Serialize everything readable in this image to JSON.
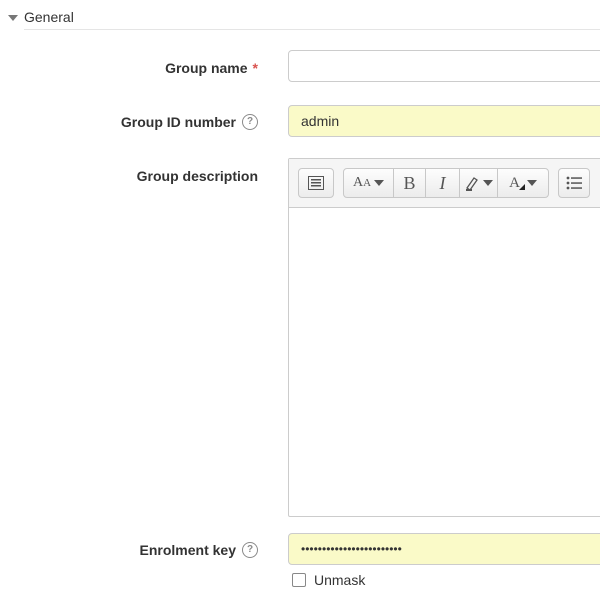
{
  "section": {
    "title": "General"
  },
  "fields": {
    "group_name": {
      "label": "Group name",
      "required_mark": "*",
      "value": ""
    },
    "group_id": {
      "label": "Group ID number",
      "help": "?",
      "value": "admin"
    },
    "description": {
      "label": "Group description"
    },
    "enrolment_key": {
      "label": "Enrolment key",
      "help": "?",
      "value": "••••••••••••••••••••••••"
    }
  },
  "toolbar": {
    "buttons": [
      {
        "name": "show-more-buttons",
        "icon": "toolbar-toggle-icon"
      },
      {
        "name": "font-style",
        "icon": "font-size-icon",
        "glyph": "AA"
      },
      {
        "name": "bold",
        "icon": "bold-icon",
        "glyph": "B"
      },
      {
        "name": "italic",
        "icon": "italic-icon",
        "glyph": "I"
      },
      {
        "name": "text-highlight",
        "icon": "highlighter-icon"
      },
      {
        "name": "font-color",
        "icon": "font-color-icon",
        "glyph": "A"
      },
      {
        "name": "list",
        "icon": "list-icon"
      }
    ]
  },
  "unmask": {
    "label": "Unmask",
    "checked": false
  }
}
